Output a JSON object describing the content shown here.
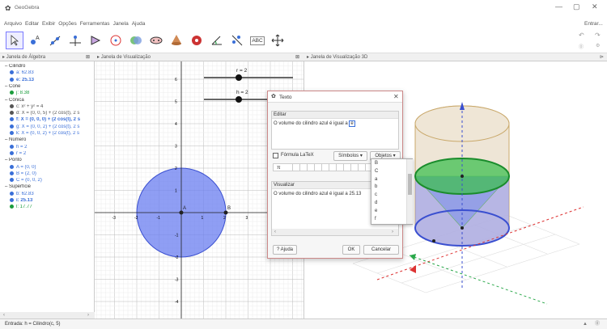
{
  "window": {
    "app_title": "GeoGebra",
    "login_label": "Entrar..."
  },
  "menu": [
    "Arquivo",
    "Editar",
    "Exibir",
    "Opções",
    "Ferramentas",
    "Janela",
    "Ajuda"
  ],
  "toolbar_text_tool": "ABC",
  "panels": {
    "algebra": "Janela de Álgebra",
    "graphics": "Janela de Visualização",
    "graphics3d": "Janela de Visualização 3D"
  },
  "algebra": [
    {
      "type": "cat",
      "text": "Cilindro"
    },
    {
      "type": "item",
      "text": "a: 62.83",
      "color": "#3a6fd8"
    },
    {
      "type": "item",
      "text": "e: 25.13",
      "color": "#3a6fd8",
      "bold": true
    },
    {
      "type": "cat",
      "text": "Cone"
    },
    {
      "type": "item",
      "text": "j: 8.38",
      "color": "#1a9c3c"
    },
    {
      "type": "cat",
      "text": "Cônica"
    },
    {
      "type": "item",
      "text": "c: x² + y² = 4",
      "color": "#555555"
    },
    {
      "type": "item",
      "text": "d: X = (0, 0, 5) + (2 cos(t), 2 s",
      "color": "#555555"
    },
    {
      "type": "item",
      "text": "f: X = (0, 0, 0) + (2 cos(t), 2 s",
      "color": "#3a6fd8",
      "bold": true
    },
    {
      "type": "item",
      "text": "g: X = (0, 0, 2) + (2 cos(t), 2 s",
      "color": "#3a6fd8"
    },
    {
      "type": "item",
      "text": "k: X = (0, 0, 2) + (2 cos(t), 2 s",
      "color": "#3a6fd8"
    },
    {
      "type": "cat",
      "text": "Número"
    },
    {
      "type": "item",
      "text": "h = 2",
      "color": "#3a6fd8"
    },
    {
      "type": "item",
      "text": "r = 2",
      "color": "#3a6fd8"
    },
    {
      "type": "cat",
      "text": "Ponto"
    },
    {
      "type": "item",
      "text": "A = (0, 0)",
      "color": "#3a6fd8"
    },
    {
      "type": "item",
      "text": "B = (2, 0)",
      "color": "#3a6fd8"
    },
    {
      "type": "item",
      "text": "C = (0, 0, 2)",
      "color": "#3a6fd8"
    },
    {
      "type": "cat",
      "text": "Superfície"
    },
    {
      "type": "item",
      "text": "b: 62.83",
      "color": "#3a6fd8"
    },
    {
      "type": "item",
      "text": "i: 25.13",
      "color": "#3a6fd8",
      "bold": true
    },
    {
      "type": "item",
      "text": "l: 17.77",
      "color": "#1a9c3c"
    }
  ],
  "graph": {
    "x_ticks": [
      "-3",
      "-2",
      "-1",
      "1",
      "2",
      "3"
    ],
    "y_ticks": [
      "6",
      "5",
      "4",
      "3",
      "2",
      "1",
      "-1",
      "-2",
      "-3",
      "-4"
    ],
    "slider_r": "r = 2",
    "slider_h": "h = 2",
    "point_a": "A",
    "point_b": "B"
  },
  "dialog": {
    "title": "Texto",
    "edit_label": "Editar",
    "edit_text": "O volume do cilindro azul é igual a ",
    "edit_obj": "e",
    "latex_label": "Fórmula LaTeX",
    "symbols_label": "Símbolos ▾",
    "objects_label": "Objetos ▾",
    "pi": "π",
    "preview_label": "Visualizar",
    "preview_text": "O volume do cilindro azul é igual a 25.13",
    "help_label": "Ajuda",
    "ok_label": "OK",
    "cancel_label": "Cancelar",
    "objects": [
      "B",
      "C",
      "a",
      "b",
      "c",
      "d",
      "e",
      "f"
    ]
  },
  "input_bar": "Entrada: h = Cilindro(c, 5)",
  "colors": {
    "accent": "#3a6fd8",
    "green": "#2aa84a",
    "red": "#d33"
  }
}
